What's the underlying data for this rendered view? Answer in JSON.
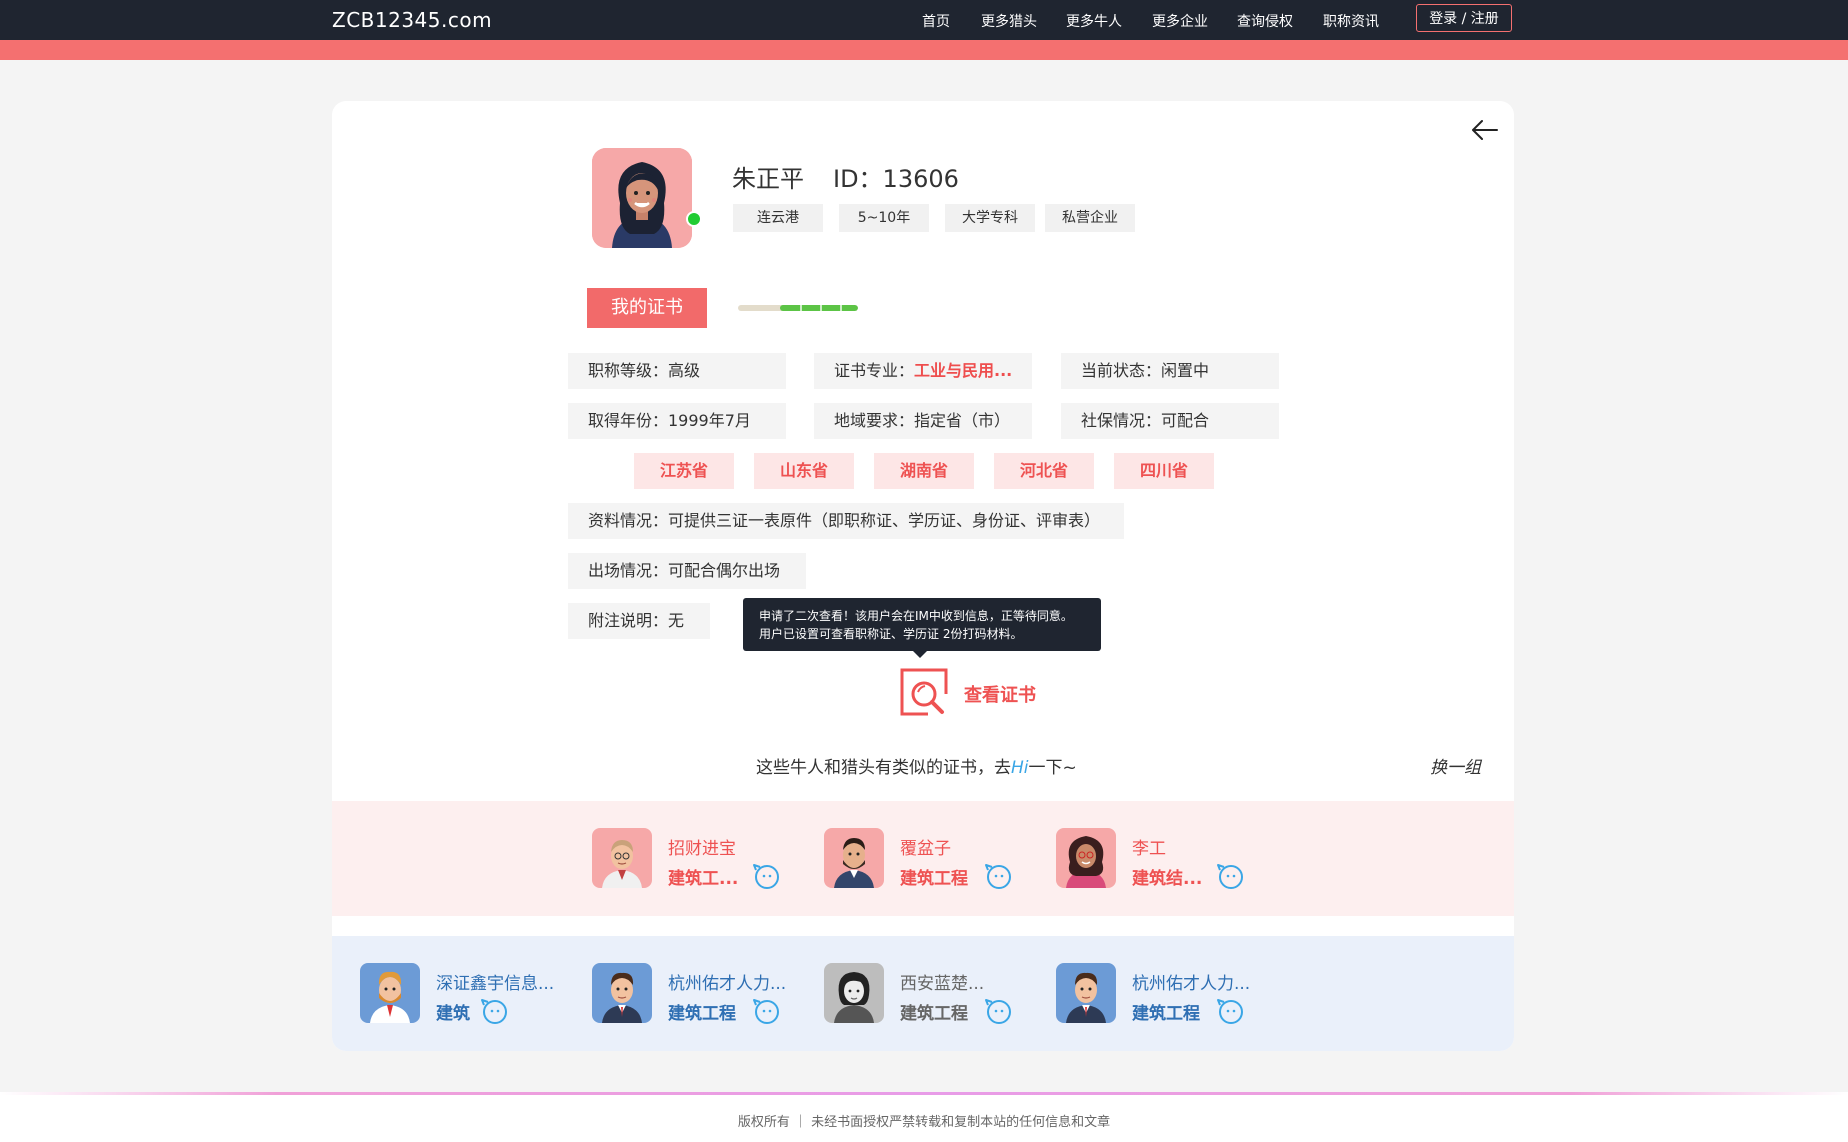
{
  "header": {
    "logo": "ZCB12345.com",
    "nav": [
      {
        "label": "首页"
      },
      {
        "label": "更多猎头"
      },
      {
        "label": "更多牛人"
      },
      {
        "label": "更多企业"
      },
      {
        "label": "查询侵权"
      },
      {
        "label": "职称资讯"
      }
    ],
    "login_label": "登录 / 注册"
  },
  "profile": {
    "name": "朱正平",
    "id_text": "ID：13606",
    "tags": [
      "连云港",
      "5~10年",
      "大学专科",
      "私营企业"
    ],
    "online": true
  },
  "certificate": {
    "tab_label": "我的证书",
    "progress": 0.65,
    "title_level": "职称等级：高级",
    "major_label": "证书专业：",
    "major_value": "工业与民用...",
    "status": "当前状态：闲置中",
    "year": "取得年份：1999年7月",
    "region_req": "地域要求：指定省（市）",
    "social_security": "社保情况：可配合",
    "provinces": [
      "江苏省",
      "山东省",
      "湖南省",
      "河北省",
      "四川省"
    ],
    "materials": "资料情况：可提供三证一表原件（即职称证、学历证、身份证、评审表）",
    "attendance": "出场情况：可配合偶尔出场",
    "remark": "附注说明：无"
  },
  "tooltip": {
    "line1": "申请了二次查看！该用户会在IM中收到信息，正等待同意。",
    "line2": "用户已设置可查看职称证、学历证 2份打码材料。"
  },
  "view_cert_label": "查看证书",
  "similar": {
    "text_before": "这些牛人和猎头有类似的证书，去",
    "hi": "Hi",
    "text_after": "一下~",
    "swap_label": "换一组"
  },
  "talents": [
    {
      "name": "招财进宝",
      "field": "建筑工..."
    },
    {
      "name": "覆盆子",
      "field": "建筑工程"
    },
    {
      "name": "李工",
      "field": "建筑结..."
    }
  ],
  "hunters": [
    {
      "name": "深证鑫宇信息...",
      "field": "建筑"
    },
    {
      "name": "杭州佑才人力...",
      "field": "建筑工程"
    },
    {
      "name": "西安蓝楚...",
      "field": "建筑工程"
    },
    {
      "name": "杭州佑才人力...",
      "field": "建筑工程"
    }
  ],
  "footer": {
    "text": "版权所有 ｜ 未经书面授权严禁转载和复制本站的任何信息和文章"
  },
  "colors": {
    "accent_red": "#f26a6a",
    "dark_nav": "#1f2530",
    "progress_green": "#5cc446",
    "hunter_blue": "#2f6fb3"
  }
}
